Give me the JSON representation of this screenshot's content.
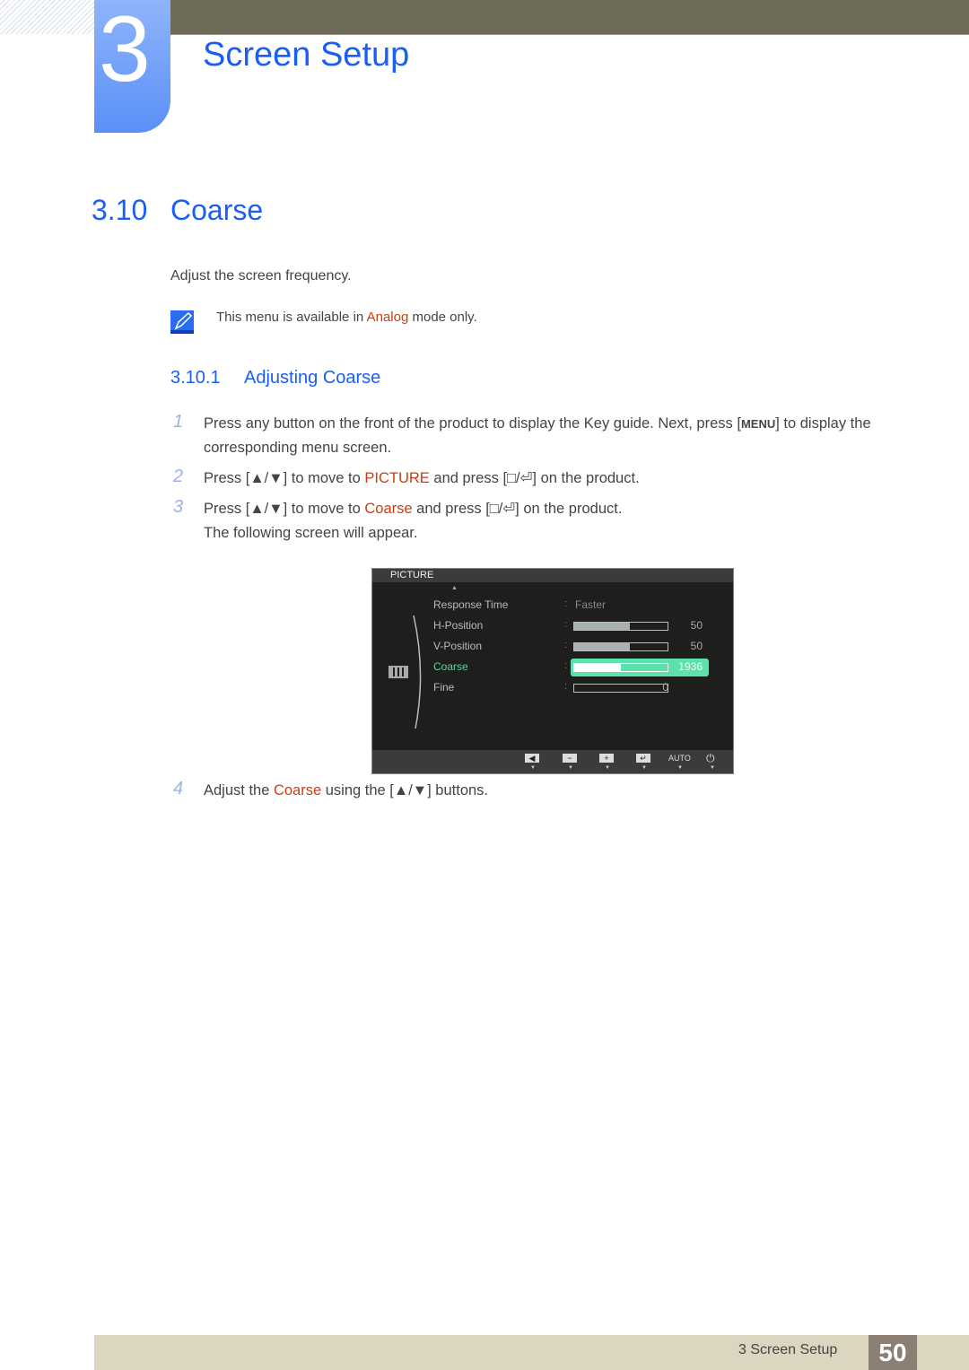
{
  "header": {
    "chapter_number": "3",
    "chapter_title": "Screen Setup"
  },
  "section": {
    "number": "3.10",
    "title": "Coarse",
    "intro": "Adjust the screen frequency."
  },
  "note": {
    "pre": "This menu is available in ",
    "highlight": "Analog",
    "post": " mode only."
  },
  "subsection": {
    "number": "3.10.1",
    "title": "Adjusting Coarse"
  },
  "steps": [
    {
      "num": "1",
      "pre": "Press any button on the front of the product to display the Key guide. Next, press [",
      "key": "MENU",
      "post": "] to display the corresponding menu screen."
    },
    {
      "num": "2",
      "pre": "Press [▲/▼] to move to ",
      "highlight": "PICTURE",
      "post": " and press [□/⏎] on the product."
    },
    {
      "num": "3",
      "pre": "Press [▲/▼] to move to ",
      "highlight": "Coarse",
      "post": " and press [□/⏎] on the product.",
      "extra": "The following screen will appear."
    },
    {
      "num": "4",
      "pre": "Adjust the ",
      "highlight": "Coarse",
      "post": " using the [▲/▼] buttons."
    }
  ],
  "osd": {
    "title": "PICTURE",
    "rows": [
      {
        "label": "Response Time",
        "value": "Faster"
      },
      {
        "label": "H-Position",
        "value": "50",
        "fill": 0.6
      },
      {
        "label": "V-Position",
        "value": "50",
        "fill": 0.6
      },
      {
        "label": "Coarse",
        "value": "1936",
        "fill": 0.5,
        "active": true
      },
      {
        "label": "Fine",
        "value": "0",
        "fill": 0
      }
    ],
    "buttons": [
      "◀",
      "−",
      "+",
      "↵",
      "AUTO",
      "⏻"
    ]
  },
  "footer": {
    "label": "3 Screen Setup",
    "page": "50"
  }
}
